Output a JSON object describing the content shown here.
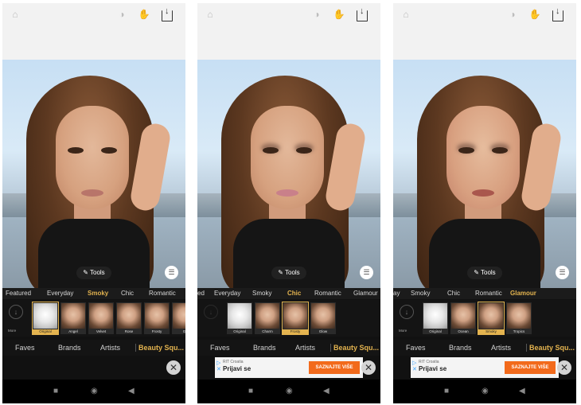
{
  "icons": {
    "home": "home-icon",
    "compare": "compare-icon",
    "hand": "hand-icon",
    "save": "download-icon",
    "tools": "paint-brush-icon",
    "favorites": "bookmark-icon",
    "close": "close-icon",
    "nav_square": "stop-icon",
    "nav_circle": "home-circle-icon",
    "nav_back": "back-triangle-icon"
  },
  "colors": {
    "accent": "#e3b34f",
    "ad_cta": "#f26a1b"
  },
  "screens": [
    {
      "tools_label": "Tools",
      "categories": [
        {
          "label": "Featured",
          "active": false
        },
        {
          "label": "Everyday",
          "active": false
        },
        {
          "label": "Smoky",
          "active": true
        },
        {
          "label": "Chic",
          "active": false
        },
        {
          "label": "Romantic",
          "active": false
        }
      ],
      "more_label": "More",
      "looks": [
        {
          "label": "Original",
          "selected": true,
          "original": true
        },
        {
          "label": "Angel",
          "selected": false,
          "original": false
        },
        {
          "label": "Velvet",
          "selected": false,
          "original": false
        },
        {
          "label": "Rose",
          "selected": false,
          "original": false
        },
        {
          "label": "Frosty",
          "selected": false,
          "original": false
        },
        {
          "label": "Gl",
          "selected": false,
          "original": false
        }
      ],
      "tabs": [
        {
          "label": "Faves",
          "active": false
        },
        {
          "label": "Brands",
          "active": false
        },
        {
          "label": "Artists",
          "active": false
        },
        {
          "label": "Beauty Squ...",
          "active": true
        }
      ],
      "ad": null
    },
    {
      "tools_label": "Tools",
      "categories": [
        {
          "label": "ed",
          "active": false
        },
        {
          "label": "Everyday",
          "active": false
        },
        {
          "label": "Smoky",
          "active": false
        },
        {
          "label": "Chic",
          "active": true
        },
        {
          "label": "Romantic",
          "active": false
        },
        {
          "label": "Glamour",
          "active": false
        }
      ],
      "more_label": "",
      "looks": [
        {
          "label": "Original",
          "selected": false,
          "original": true
        },
        {
          "label": "Charm",
          "selected": false,
          "original": false
        },
        {
          "label": "Frosty",
          "selected": true,
          "original": false
        },
        {
          "label": "Glow",
          "selected": false,
          "original": false
        }
      ],
      "tabs": [
        {
          "label": "Faves",
          "active": false
        },
        {
          "label": "Brands",
          "active": false
        },
        {
          "label": "Artists",
          "active": false
        },
        {
          "label": "Beauty Squ...",
          "active": true
        }
      ],
      "ad": {
        "brand": "RIT Croatia",
        "text": "Prijavi se",
        "cta": "SAZNAJTE VIŠE"
      }
    },
    {
      "tools_label": "Tools",
      "categories": [
        {
          "label": "ay",
          "active": false
        },
        {
          "label": "Smoky",
          "active": false
        },
        {
          "label": "Chic",
          "active": false
        },
        {
          "label": "Romantic",
          "active": false
        },
        {
          "label": "Glamour",
          "active": true
        }
      ],
      "more_label": "More",
      "looks": [
        {
          "label": "Original",
          "selected": false,
          "original": true
        },
        {
          "label": "Ocean",
          "selected": false,
          "original": false
        },
        {
          "label": "Smoky",
          "selected": true,
          "original": false
        },
        {
          "label": "Tropics",
          "selected": false,
          "original": false
        }
      ],
      "tabs": [
        {
          "label": "Faves",
          "active": false
        },
        {
          "label": "Brands",
          "active": false
        },
        {
          "label": "Artists",
          "active": false
        },
        {
          "label": "Beauty Squ...",
          "active": true
        }
      ],
      "ad": {
        "brand": "RIT Croatia",
        "text": "Prijavi se",
        "cta": "SAZNAJTE VIŠE"
      }
    }
  ]
}
